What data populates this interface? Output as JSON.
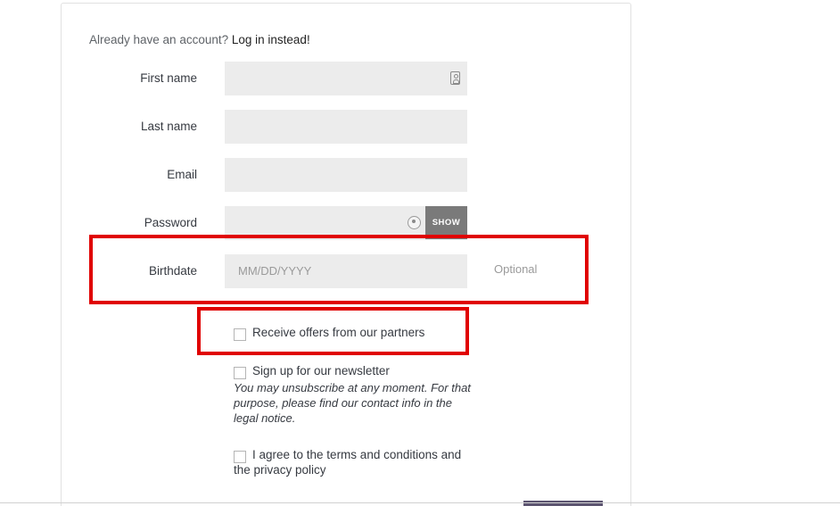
{
  "login": {
    "prompt": "Already have an account?",
    "link": "Log in instead!"
  },
  "fields": {
    "first_name": {
      "label": "First name",
      "value": "",
      "icon": "contact-card-icon"
    },
    "last_name": {
      "label": "Last name",
      "value": ""
    },
    "email": {
      "label": "Email",
      "value": ""
    },
    "password": {
      "label": "Password",
      "value": "",
      "show_label": "SHOW"
    },
    "birthdate": {
      "label": "Birthdate",
      "placeholder": "MM/DD/YYYY",
      "optional": "Optional"
    }
  },
  "checkboxes": {
    "partners": {
      "label": "Receive offers from our partners",
      "checked": false
    },
    "newsletter": {
      "label": "Sign up for our newsletter",
      "checked": false,
      "note": "You may unsubscribe at any moment. For that purpose, please find our contact info in the legal notice."
    },
    "terms": {
      "label": "I agree to the terms and conditions and the privacy policy",
      "checked": false
    }
  },
  "colors": {
    "highlight": "#e00000",
    "field_bg": "#ececec",
    "show_button": "#7a7a7a",
    "submit_button": "#5c5470"
  }
}
